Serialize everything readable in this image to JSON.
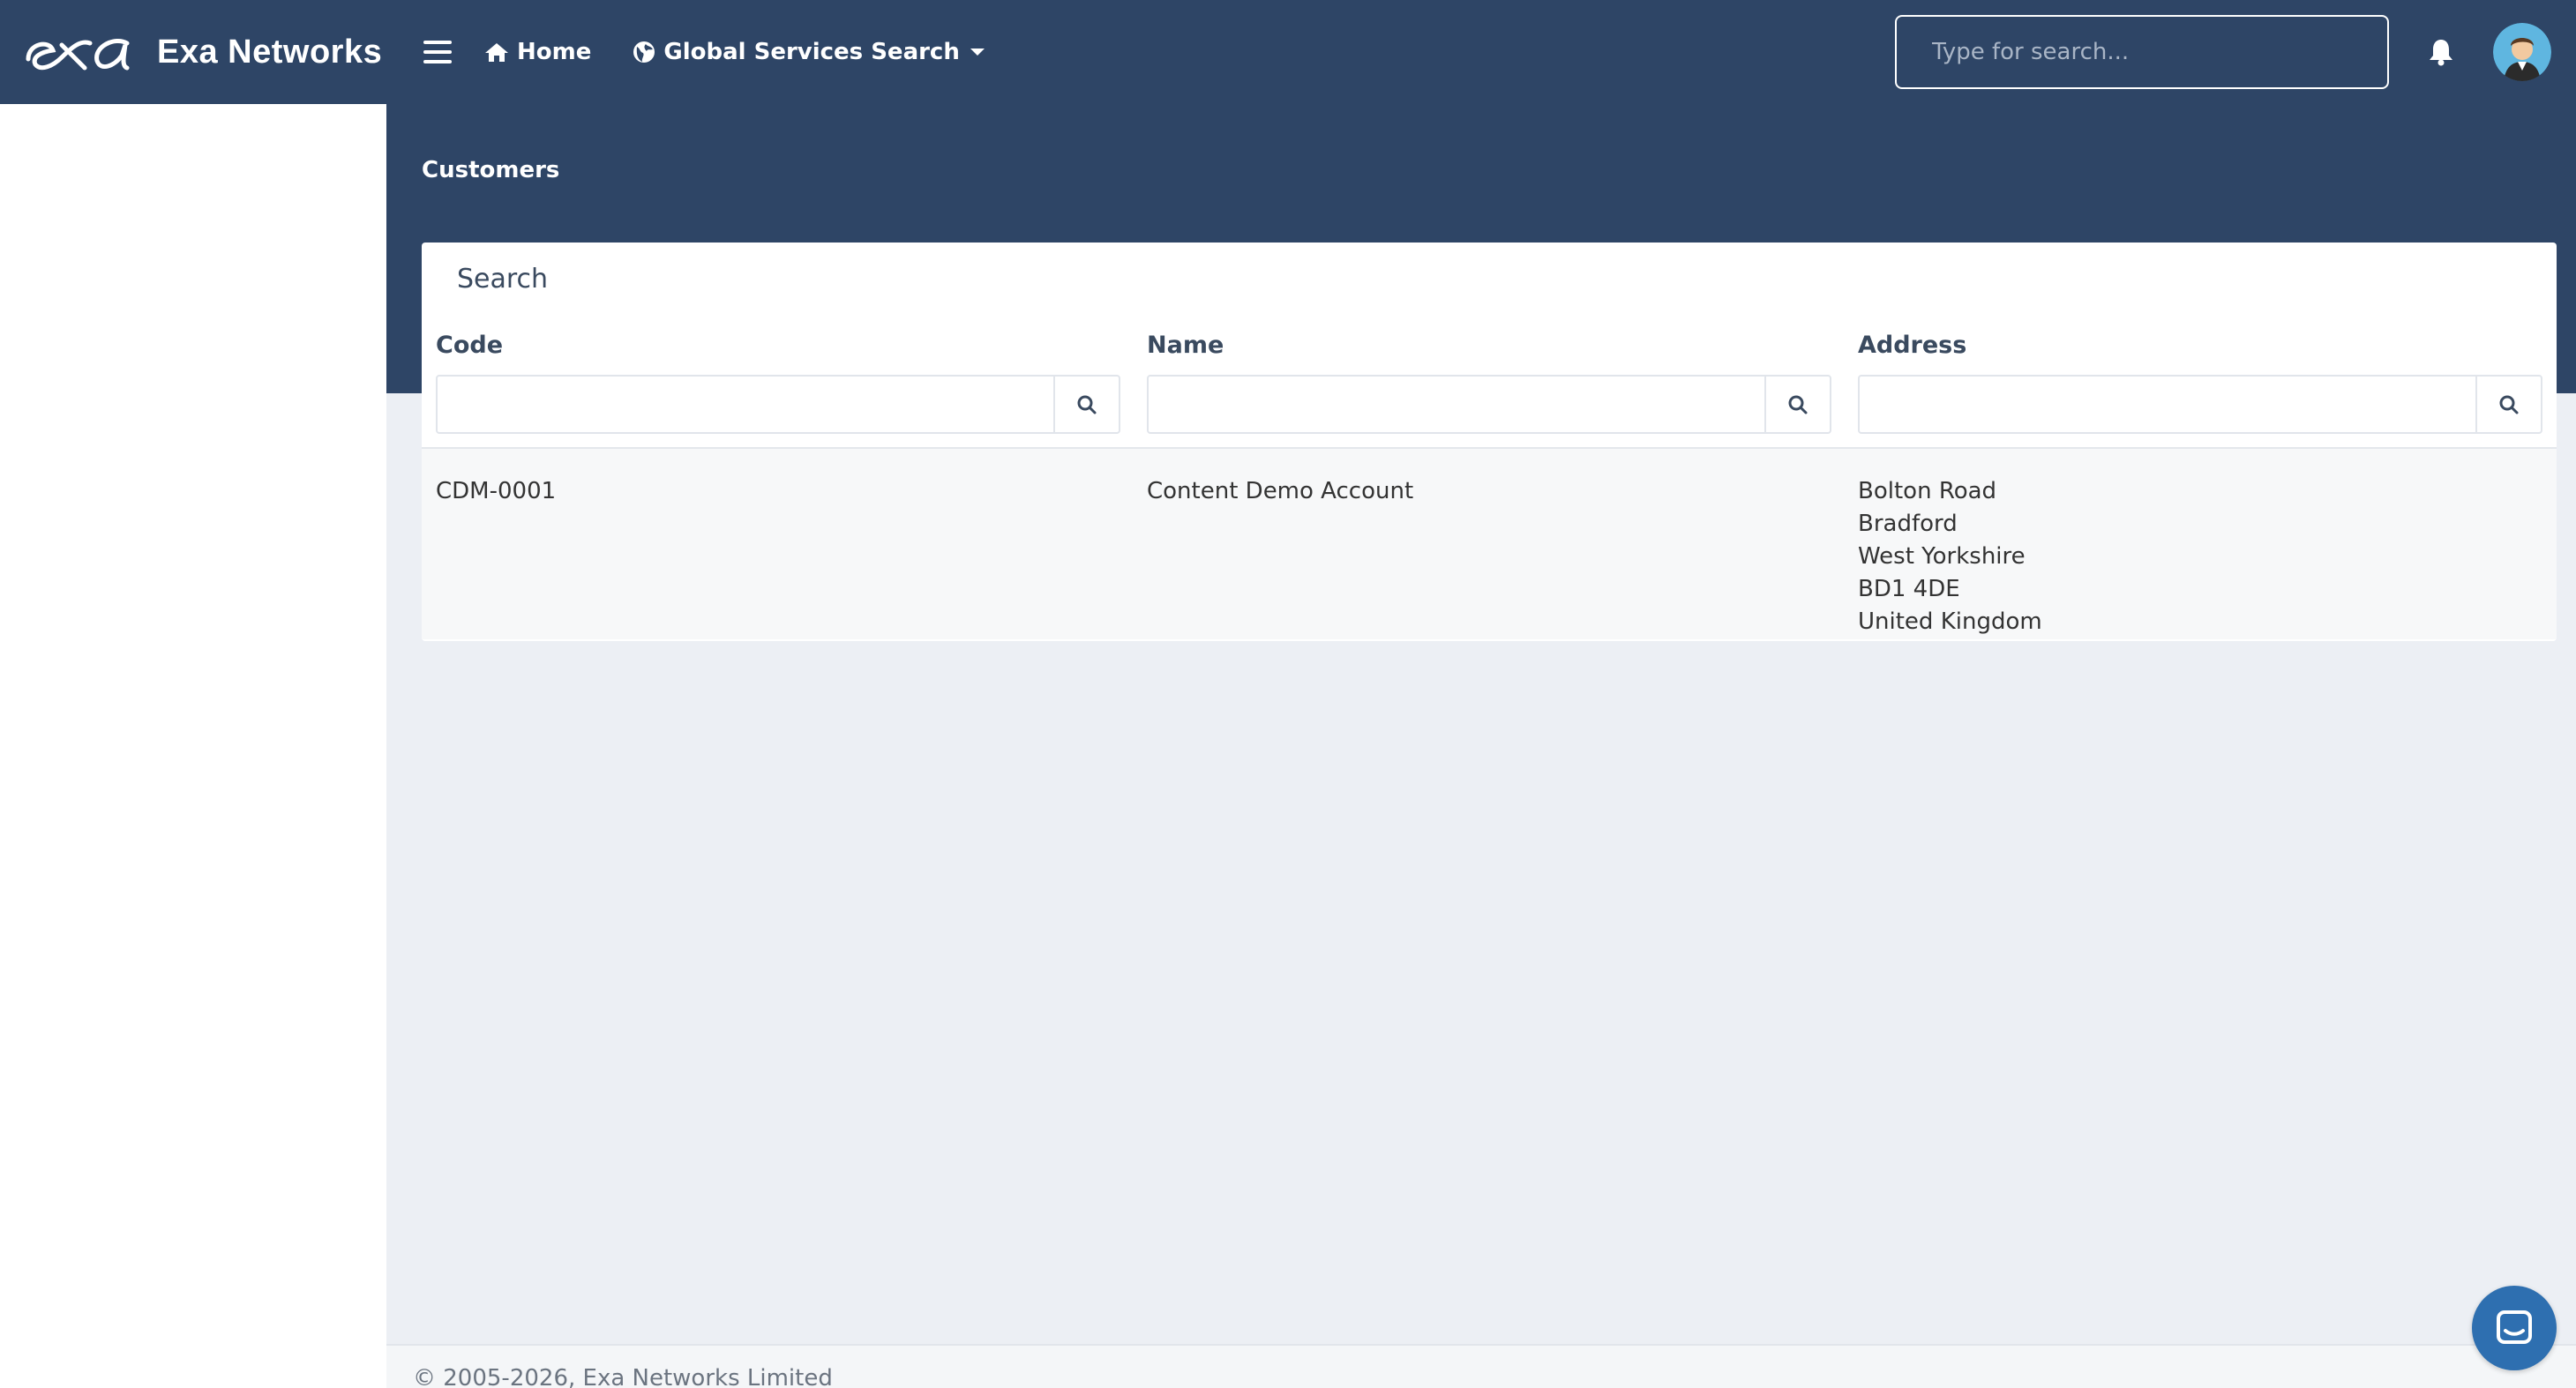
{
  "app": {
    "brand_name": "Exa Networks"
  },
  "nav": {
    "home_label": "Home",
    "global_search_label": "Global Services Search",
    "search_placeholder": "Type for search..."
  },
  "page": {
    "title": "Customers"
  },
  "search_card": {
    "title": "Search",
    "columns": [
      "Code",
      "Name",
      "Address"
    ],
    "filters": [
      {
        "value": "",
        "placeholder": ""
      },
      {
        "value": "",
        "placeholder": ""
      },
      {
        "value": "",
        "placeholder": ""
      }
    ],
    "rows": [
      {
        "code": "CDM-0001",
        "name": "Content Demo Account",
        "address": [
          "Bolton Road",
          "Bradford",
          "West Yorkshire",
          "BD1 4DE",
          "United Kingdom"
        ]
      }
    ]
  },
  "footer": {
    "copyright": "© 2005-2026, Exa Networks Limited"
  },
  "icons": {
    "menu": "hamburger-icon",
    "home": "home-icon",
    "globe": "globe-icon",
    "bell": "bell-icon",
    "search": "search-icon",
    "chat": "chat-icon"
  },
  "colors": {
    "navbar": "#2e4566",
    "background": "#eceff4",
    "chat_button": "#2e6fb0"
  }
}
